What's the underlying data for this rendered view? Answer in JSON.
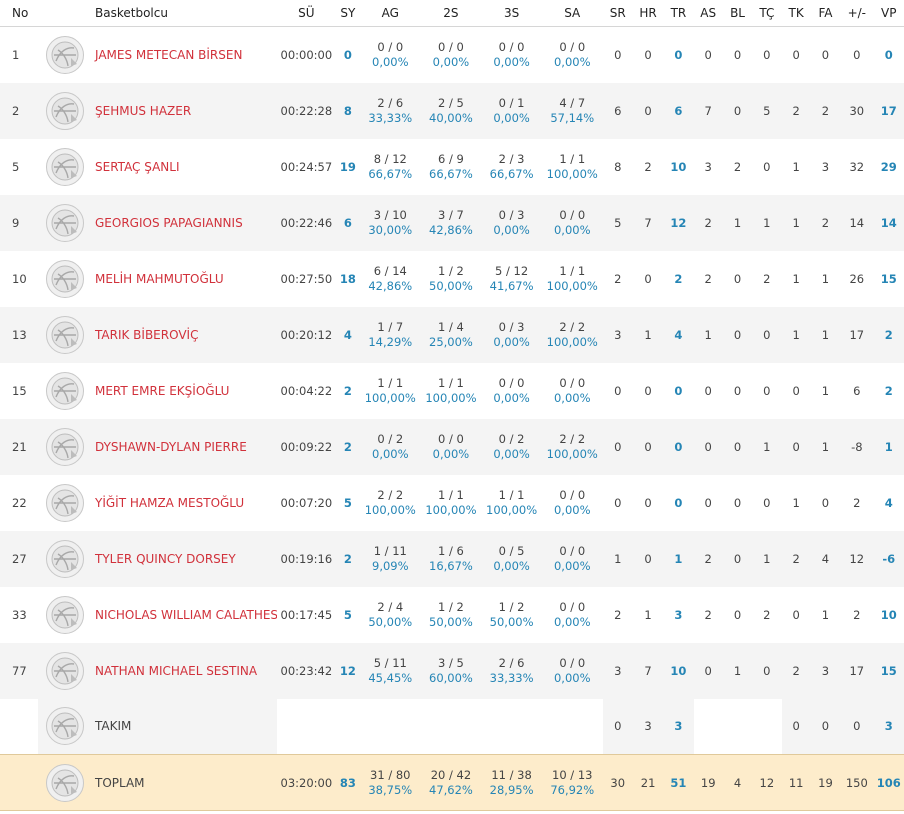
{
  "headers": {
    "no": "No",
    "player": "Basketbolcu",
    "su": "SÜ",
    "sy": "SY",
    "ag": "AG",
    "s2": "2S",
    "s3": "3S",
    "sa": "SA",
    "sr": "SR",
    "hr": "HR",
    "tr": "TR",
    "as": "AS",
    "bl": "BL",
    "tc": "TÇ",
    "tk": "TK",
    "fa": "FA",
    "pm": "+/-",
    "vp": "VP"
  },
  "players": [
    {
      "no": "1",
      "name": "JAMES METECAN BİRSEN",
      "su": "00:00:00",
      "sy": "0",
      "ag": "0 / 0",
      "ag_pct": "0,00%",
      "s2": "0 / 0",
      "s2_pct": "0,00%",
      "s3": "0 / 0",
      "s3_pct": "0,00%",
      "sa": "0 / 0",
      "sa_pct": "0,00%",
      "sr": "0",
      "hr": "0",
      "tr": "0",
      "as": "0",
      "bl": "0",
      "tc": "0",
      "tk": "0",
      "fa": "0",
      "pm": "0",
      "vp": "0",
      "avatar_icon": "player-avatar-icon"
    },
    {
      "no": "2",
      "name": "ŞEHMUS HAZER",
      "su": "00:22:28",
      "sy": "8",
      "ag": "2 / 6",
      "ag_pct": "33,33%",
      "s2": "2 / 5",
      "s2_pct": "40,00%",
      "s3": "0 / 1",
      "s3_pct": "0,00%",
      "sa": "4 / 7",
      "sa_pct": "57,14%",
      "sr": "6",
      "hr": "0",
      "tr": "6",
      "as": "7",
      "bl": "0",
      "tc": "5",
      "tk": "2",
      "fa": "2",
      "pm": "30",
      "vp": "17",
      "avatar_icon": "player-avatar-icon"
    },
    {
      "no": "5",
      "name": "SERTAÇ ŞANLI",
      "su": "00:24:57",
      "sy": "19",
      "ag": "8 / 12",
      "ag_pct": "66,67%",
      "s2": "6 / 9",
      "s2_pct": "66,67%",
      "s3": "2 / 3",
      "s3_pct": "66,67%",
      "sa": "1 / 1",
      "sa_pct": "100,00%",
      "sr": "8",
      "hr": "2",
      "tr": "10",
      "as": "3",
      "bl": "2",
      "tc": "0",
      "tk": "1",
      "fa": "3",
      "pm": "32",
      "vp": "29",
      "avatar_icon": "player-avatar-icon"
    },
    {
      "no": "9",
      "name": "GEORGIOS PAPAGIANNIS",
      "su": "00:22:46",
      "sy": "6",
      "ag": "3 / 10",
      "ag_pct": "30,00%",
      "s2": "3 / 7",
      "s2_pct": "42,86%",
      "s3": "0 / 3",
      "s3_pct": "0,00%",
      "sa": "0 / 0",
      "sa_pct": "0,00%",
      "sr": "5",
      "hr": "7",
      "tr": "12",
      "as": "2",
      "bl": "1",
      "tc": "1",
      "tk": "1",
      "fa": "2",
      "pm": "14",
      "vp": "14",
      "avatar_icon": "player-avatar-icon"
    },
    {
      "no": "10",
      "name": "MELİH MAHMUTOĞLU",
      "su": "00:27:50",
      "sy": "18",
      "ag": "6 / 14",
      "ag_pct": "42,86%",
      "s2": "1 / 2",
      "s2_pct": "50,00%",
      "s3": "5 / 12",
      "s3_pct": "41,67%",
      "sa": "1 / 1",
      "sa_pct": "100,00%",
      "sr": "2",
      "hr": "0",
      "tr": "2",
      "as": "2",
      "bl": "0",
      "tc": "2",
      "tk": "1",
      "fa": "1",
      "pm": "26",
      "vp": "15",
      "avatar_icon": "player-avatar-icon"
    },
    {
      "no": "13",
      "name": "TARIK BİBEROVİÇ",
      "su": "00:20:12",
      "sy": "4",
      "ag": "1 / 7",
      "ag_pct": "14,29%",
      "s2": "1 / 4",
      "s2_pct": "25,00%",
      "s3": "0 / 3",
      "s3_pct": "0,00%",
      "sa": "2 / 2",
      "sa_pct": "100,00%",
      "sr": "3",
      "hr": "1",
      "tr": "4",
      "as": "1",
      "bl": "0",
      "tc": "0",
      "tk": "1",
      "fa": "1",
      "pm": "17",
      "vp": "2",
      "avatar_icon": "player-avatar-icon"
    },
    {
      "no": "15",
      "name": "MERT EMRE EKŞİOĞLU",
      "su": "00:04:22",
      "sy": "2",
      "ag": "1 / 1",
      "ag_pct": "100,00%",
      "s2": "1 / 1",
      "s2_pct": "100,00%",
      "s3": "0 / 0",
      "s3_pct": "0,00%",
      "sa": "0 / 0",
      "sa_pct": "0,00%",
      "sr": "0",
      "hr": "0",
      "tr": "0",
      "as": "0",
      "bl": "0",
      "tc": "0",
      "tk": "0",
      "fa": "1",
      "pm": "6",
      "vp": "2",
      "avatar_icon": "player-avatar-icon"
    },
    {
      "no": "21",
      "name": "DYSHAWN-DYLAN PIERRE",
      "su": "00:09:22",
      "sy": "2",
      "ag": "0 / 2",
      "ag_pct": "0,00%",
      "s2": "0 / 0",
      "s2_pct": "0,00%",
      "s3": "0 / 2",
      "s3_pct": "0,00%",
      "sa": "2 / 2",
      "sa_pct": "100,00%",
      "sr": "0",
      "hr": "0",
      "tr": "0",
      "as": "0",
      "bl": "0",
      "tc": "1",
      "tk": "0",
      "fa": "1",
      "pm": "-8",
      "vp": "1",
      "avatar_icon": "player-avatar-icon"
    },
    {
      "no": "22",
      "name": "YİĞİT HAMZA MESTOĞLU",
      "su": "00:07:20",
      "sy": "5",
      "ag": "2 / 2",
      "ag_pct": "100,00%",
      "s2": "1 / 1",
      "s2_pct": "100,00%",
      "s3": "1 / 1",
      "s3_pct": "100,00%",
      "sa": "0 / 0",
      "sa_pct": "0,00%",
      "sr": "0",
      "hr": "0",
      "tr": "0",
      "as": "0",
      "bl": "0",
      "tc": "0",
      "tk": "1",
      "fa": "0",
      "pm": "2",
      "vp": "4",
      "avatar_icon": "player-avatar-icon"
    },
    {
      "no": "27",
      "name": "TYLER QUINCY DORSEY",
      "su": "00:19:16",
      "sy": "2",
      "ag": "1 / 11",
      "ag_pct": "9,09%",
      "s2": "1 / 6",
      "s2_pct": "16,67%",
      "s3": "0 / 5",
      "s3_pct": "0,00%",
      "sa": "0 / 0",
      "sa_pct": "0,00%",
      "sr": "1",
      "hr": "0",
      "tr": "1",
      "as": "2",
      "bl": "0",
      "tc": "1",
      "tk": "2",
      "fa": "4",
      "pm": "12",
      "vp": "-6",
      "avatar_icon": "player-avatar-icon"
    },
    {
      "no": "33",
      "name": "NICHOLAS WILLIAM CALATHES",
      "su": "00:17:45",
      "sy": "5",
      "ag": "2 / 4",
      "ag_pct": "50,00%",
      "s2": "1 / 2",
      "s2_pct": "50,00%",
      "s3": "1 / 2",
      "s3_pct": "50,00%",
      "sa": "0 / 0",
      "sa_pct": "0,00%",
      "sr": "2",
      "hr": "1",
      "tr": "3",
      "as": "2",
      "bl": "0",
      "tc": "2",
      "tk": "0",
      "fa": "1",
      "pm": "2",
      "vp": "10",
      "avatar_icon": "player-avatar-icon"
    },
    {
      "no": "77",
      "name": "NATHAN MICHAEL SESTINA",
      "su": "00:23:42",
      "sy": "12",
      "ag": "5 / 11",
      "ag_pct": "45,45%",
      "s2": "3 / 5",
      "s2_pct": "60,00%",
      "s3": "2 / 6",
      "s3_pct": "33,33%",
      "sa": "0 / 0",
      "sa_pct": "0,00%",
      "sr": "3",
      "hr": "7",
      "tr": "10",
      "as": "0",
      "bl": "1",
      "tc": "0",
      "tk": "2",
      "fa": "3",
      "pm": "17",
      "vp": "15",
      "avatar_icon": "player-avatar-icon"
    }
  ],
  "team": {
    "name": "TAKIM",
    "sr": "0",
    "hr": "3",
    "tr": "3",
    "tk": "0",
    "fa": "0",
    "pm": "0",
    "vp": "3",
    "avatar_icon": "team-avatar-icon"
  },
  "total": {
    "name": "TOPLAM",
    "su": "03:20:00",
    "sy": "83",
    "ag": "31 / 80",
    "ag_pct": "38,75%",
    "s2": "20 / 42",
    "s2_pct": "47,62%",
    "s3": "11 / 38",
    "s3_pct": "28,95%",
    "sa": "10 / 13",
    "sa_pct": "76,92%",
    "sr": "30",
    "hr": "21",
    "tr": "51",
    "as": "19",
    "bl": "4",
    "tc": "12",
    "tk": "11",
    "fa": "19",
    "pm": "150",
    "vp": "106",
    "avatar_icon": "total-avatar-icon"
  },
  "colors": {
    "name_red": "#d1313b",
    "accent_blue": "#2585b5",
    "total_bg": "#fdeccb",
    "stripe": "#f4f4f4"
  }
}
